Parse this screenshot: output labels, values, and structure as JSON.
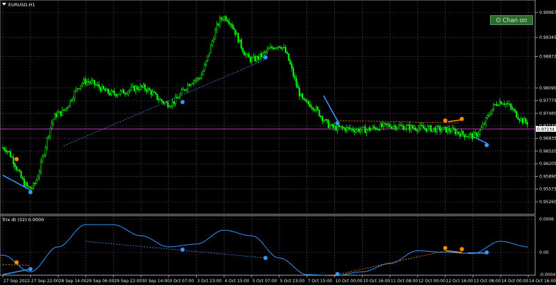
{
  "window": {
    "symbol_title": "EURUSD,H1",
    "menu_glyph": "down-triangle"
  },
  "button": {
    "label": "O Chan on",
    "color": "#2d6a2d"
  },
  "main_pane": {
    "price_labels": [
      "0.99967",
      "0.99345",
      "0.98872",
      "0.98090",
      "0.97775",
      "0.97460",
      "0.97146",
      "0.96835",
      "0.96520",
      "0.96205",
      "0.95890",
      "0.95575",
      "0.95260"
    ],
    "current_price": "0.97234",
    "candle_color": "#00ff00",
    "trend_line_color": "#3399ff",
    "signal_color": "#ff8c00"
  },
  "sub_pane": {
    "title": "Trix dt (32) 0.0000",
    "scale_labels": [
      "0.0006",
      "0.00",
      "-0.0004"
    ],
    "line_color": "#3399ff"
  },
  "time_axis": [
    "27 Sep 2022",
    "27 Sep 22:00",
    "28 Sep 14:00",
    "29 Sep 06:00",
    "29 Sep 22:00",
    "30 Sep 14:00",
    "3 Oct 07:00",
    "3 Oct 23:00",
    "4 Oct 15:00",
    "5 Oct 07:00",
    "5 Oct 23:00",
    "7 Oct 15:00",
    "10 Oct 00:00",
    "10 Oct 16:00",
    "11 Oct 08:00",
    "12 Oct 00:00",
    "12 Oct 16:00",
    "13 Oct 08:00",
    "14 Oct 00:00",
    "14 Oct 16:00"
  ],
  "chart_data": {
    "type": "candlestick",
    "symbol": "EURUSD",
    "timeframe": "H1",
    "anchors": [
      [
        "27 Sep 2022",
        0.966
      ],
      [
        "27 Sep 22:00",
        0.956
      ],
      [
        "28 Sep 14:00",
        0.9745
      ],
      [
        "29 Sep 06:00",
        0.9825
      ],
      [
        "29 Sep 22:00",
        0.9795
      ],
      [
        "30 Sep 14:00",
        0.981
      ],
      [
        "3 Oct 07:00",
        0.977
      ],
      [
        "3 Oct 23:00",
        0.983
      ],
      [
        "4 Oct 15:00",
        0.9985
      ],
      [
        "5 Oct 07:00",
        0.988
      ],
      [
        "5 Oct 23:00",
        0.9915
      ],
      [
        "7 Oct 15:00",
        0.977
      ],
      [
        "10 Oct 00:00",
        0.971
      ],
      [
        "10 Oct 16:00",
        0.9705
      ],
      [
        "11 Oct 08:00",
        0.9715
      ],
      [
        "12 Oct 00:00",
        0.971
      ],
      [
        "12 Oct 16:00",
        0.9705
      ],
      [
        "13 Oct 08:00",
        0.969
      ],
      [
        "14 Oct 00:00",
        0.9775
      ],
      [
        "14 Oct 16:00",
        0.9723
      ]
    ],
    "trix_anchors": [
      [
        "27 Sep 2022",
        -5e-05
      ],
      [
        "27 Sep 22:00",
        -0.00035
      ],
      [
        "28 Sep 14:00",
        0.0001
      ],
      [
        "29 Sep 06:00",
        0.0005
      ],
      [
        "29 Sep 22:00",
        0.0005
      ],
      [
        "30 Sep 14:00",
        0.0003
      ],
      [
        "3 Oct 07:00",
        0.0001
      ],
      [
        "3 Oct 23:00",
        0.00015
      ],
      [
        "4 Oct 15:00",
        0.0004
      ],
      [
        "5 Oct 07:00",
        0.0003
      ],
      [
        "5 Oct 23:00",
        -0.0001
      ],
      [
        "7 Oct 15:00",
        -0.0004
      ],
      [
        "10 Oct 00:00",
        -0.00042
      ],
      [
        "10 Oct 16:00",
        -0.00035
      ],
      [
        "11 Oct 08:00",
        -0.0002
      ],
      [
        "12 Oct 00:00",
        3e-05
      ],
      [
        "12 Oct 16:00",
        0.0
      ],
      [
        "13 Oct 08:00",
        -2e-05
      ],
      [
        "14 Oct 00:00",
        0.0002
      ],
      [
        "14 Oct 16:00",
        0.0001
      ]
    ]
  }
}
